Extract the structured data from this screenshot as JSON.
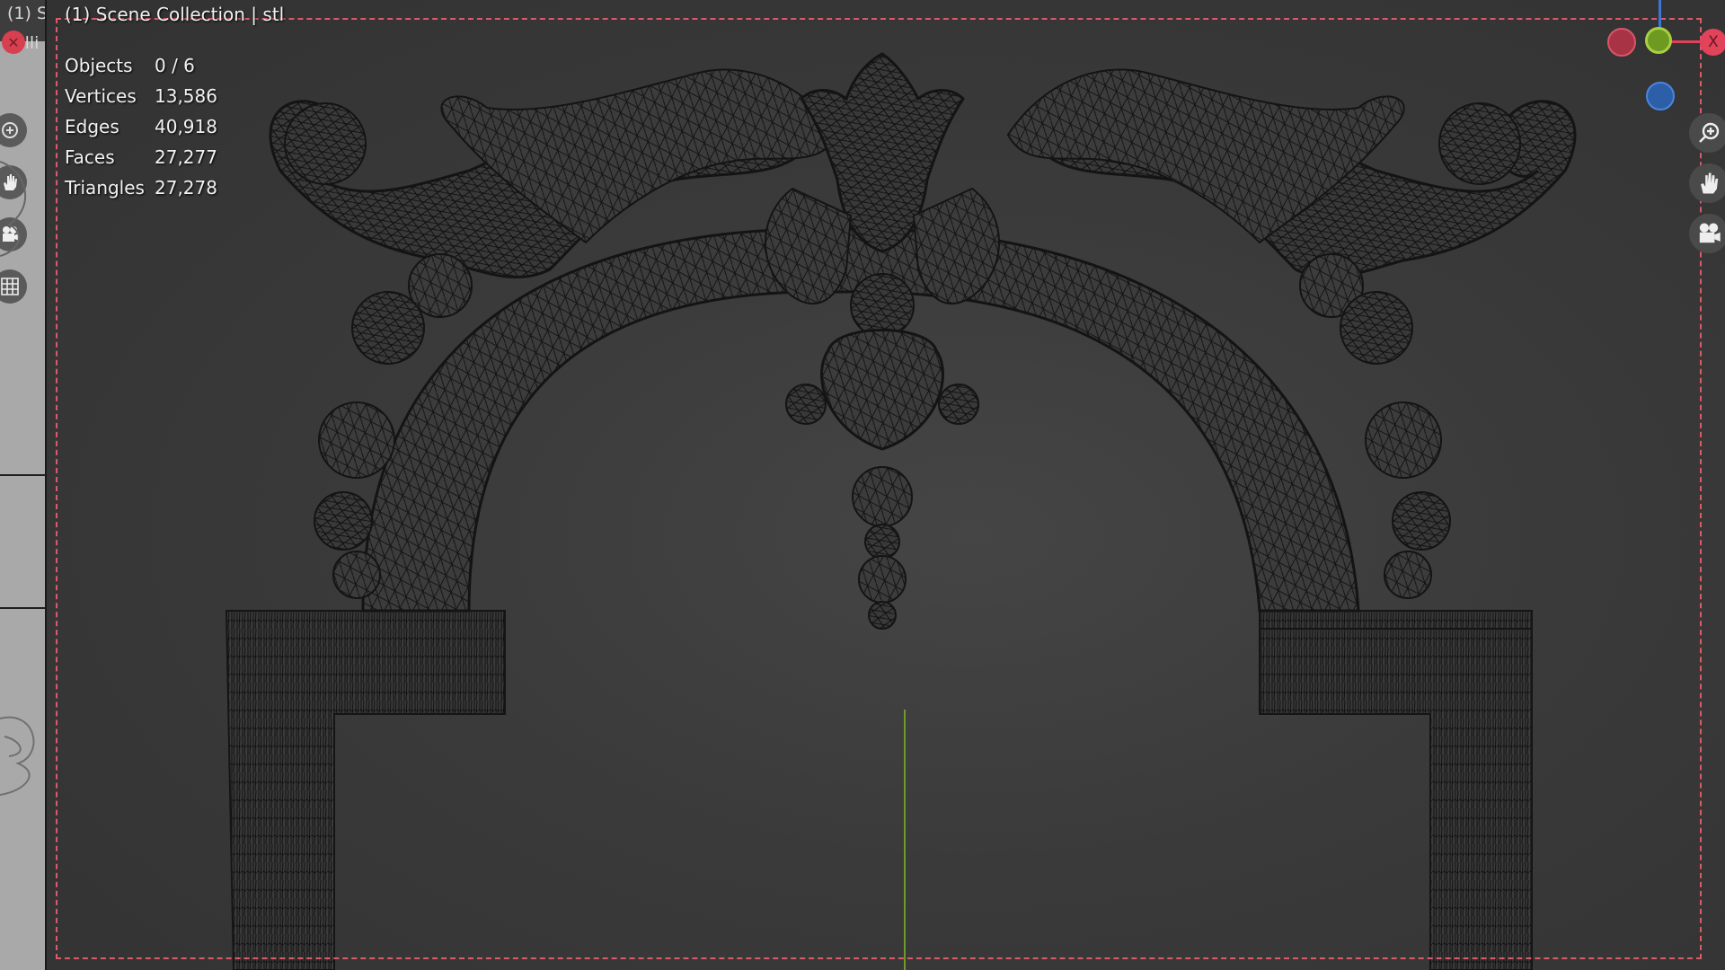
{
  "left_panel": {
    "title": "(1) S",
    "subtitle": "Illi",
    "tools": [
      {
        "name": "zoom-in-icon"
      },
      {
        "name": "hand-icon"
      },
      {
        "name": "camera-icon"
      },
      {
        "name": "grid-icon"
      }
    ]
  },
  "viewport": {
    "title": "(1) Scene Collection | stl",
    "stats": [
      {
        "label": "Objects",
        "value": "0 / 6"
      },
      {
        "label": "Vertices",
        "value": "13,586"
      },
      {
        "label": "Edges",
        "value": "40,918"
      },
      {
        "label": "Faces",
        "value": "27,277"
      },
      {
        "label": "Triangles",
        "value": "27,278"
      }
    ]
  },
  "gizmo": {
    "x_label": "X",
    "x_color": "#e0435a",
    "y_color": "#8ab82b",
    "z_color": "#3a77d6",
    "neg_x_color": "#a83345"
  },
  "colors": {
    "camera_frame": "#d95b6a",
    "wire": "#141414",
    "y_axis_line": "#6d9a2a"
  }
}
